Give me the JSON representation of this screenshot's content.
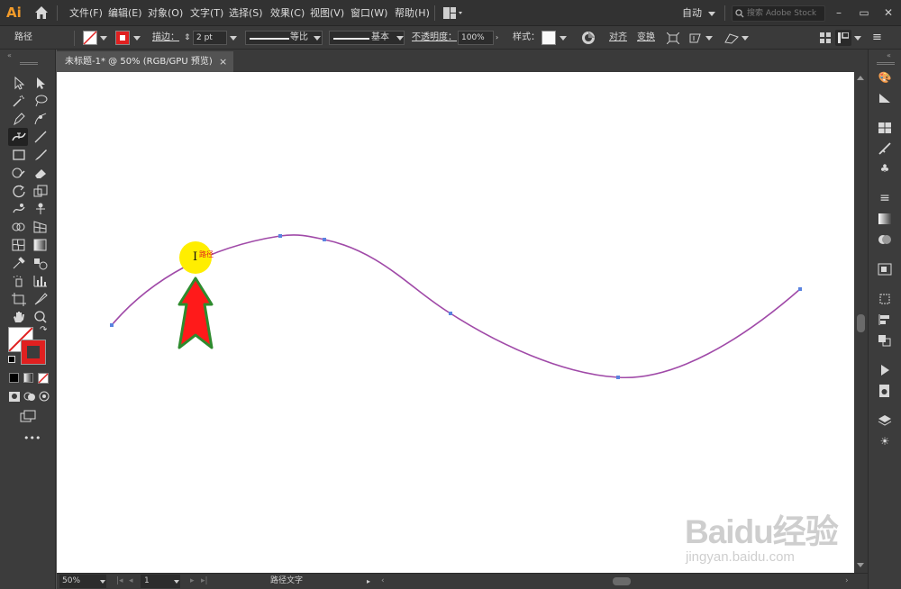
{
  "app": {
    "logo": "Ai"
  },
  "menu": {
    "items": [
      "文件(F)",
      "编辑(E)",
      "对象(O)",
      "文字(T)",
      "选择(S)",
      "效果(C)",
      "视图(V)",
      "窗口(W)",
      "帮助(H)"
    ]
  },
  "workspace": {
    "label": "自动"
  },
  "search": {
    "placeholder": "搜索 Adobe Stock"
  },
  "control": {
    "selection_type": "路径",
    "stroke_label": "描边：",
    "stroke_weight": "2 pt",
    "profile_label": "等比",
    "brush_label": "基本",
    "opacity_label": "不透明度：",
    "opacity_value": "100%",
    "style_label": "样式：",
    "align_label": "对齐",
    "transform_label": "变换"
  },
  "document": {
    "tab_title": "未标题-1* @ 50% (RGB/GPU 预览)",
    "close": "×"
  },
  "canvas": {
    "cursor_label": "I",
    "cursor_hint": "路径",
    "curve_color": "#a04aa8",
    "arrow_color": "#ff1a1a",
    "arrow_outline": "#2e8b2e",
    "highlight_color": "#ffee00"
  },
  "status": {
    "zoom": "50%",
    "artboard": "1",
    "tool_name": "路径文字"
  },
  "watermark": {
    "brand": "Baidu经验",
    "url": "jingyan.baidu.com"
  },
  "more": "•••"
}
